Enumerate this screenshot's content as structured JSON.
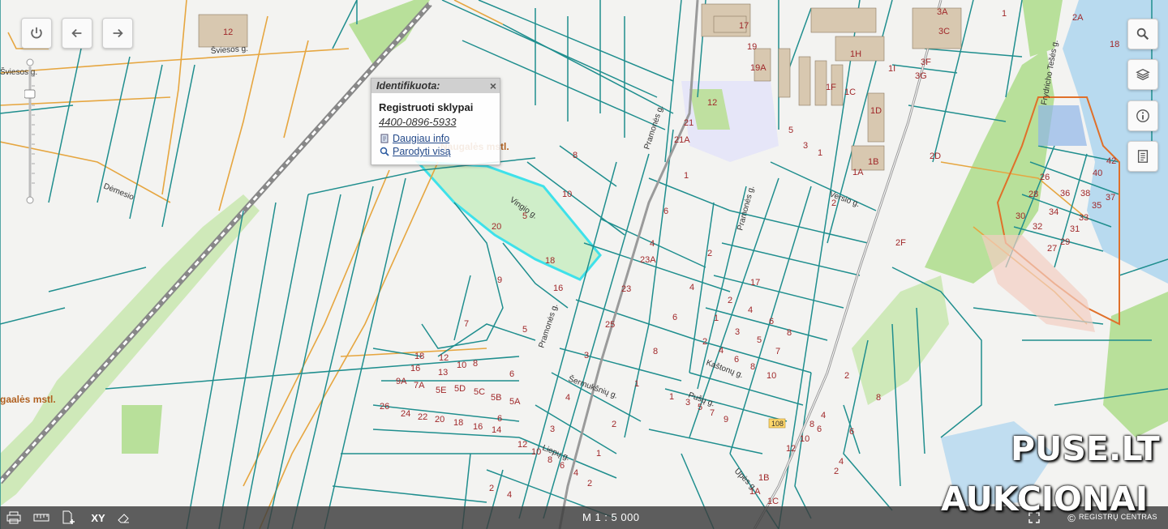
{
  "toolbar": {
    "power_icon": "power-icon",
    "back_icon": "arrow-left-icon",
    "forward_icon": "arrow-right-icon"
  },
  "right_tools": [
    "search-icon",
    "layers-icon",
    "info-icon",
    "legend-icon"
  ],
  "popup": {
    "title": "Identifikuota:",
    "close": "×",
    "section": "Registruoti sklypai",
    "plot_id": "4400-0896-5933",
    "more_info": "Daugiau info",
    "show_all": "Parodyti visą"
  },
  "streets": [
    "Šviesos g.",
    "Dėmesio",
    "Vingio g.",
    "Pramonės g.",
    "Verslo g.",
    "Pramonės g.",
    "Šermukšnių g.",
    "Kaštonų g.",
    "Pušų g.",
    "Liepų g.",
    "Upės g.",
    "Frydricho Tešės g."
  ],
  "places": [
    "Naugalės mstl.",
    "gaalės mstl."
  ],
  "road_number": "108",
  "plot_numbers": [
    "12",
    "1",
    "17",
    "19",
    "19A",
    "18",
    "12",
    "3A",
    "3C",
    "3F",
    "3G",
    "1A",
    "1H",
    "1I",
    "1F",
    "1C",
    "1D",
    "1B",
    "2A",
    "2",
    "3",
    "5",
    "1",
    "21",
    "21A",
    "1",
    "8",
    "10",
    "5",
    "20",
    "18",
    "6",
    "4",
    "23A",
    "2",
    "23",
    "4",
    "9",
    "16",
    "7",
    "5",
    "25",
    "6",
    "8",
    "3",
    "1",
    "4",
    "2",
    "3",
    "17",
    "2",
    "4",
    "6",
    "8",
    "1",
    "3",
    "5",
    "7",
    "2",
    "4",
    "6",
    "8",
    "10",
    "1",
    "3",
    "5",
    "7",
    "9",
    "2D",
    "2F",
    "26",
    "28",
    "30",
    "32",
    "34",
    "36",
    "38",
    "40",
    "42",
    "37",
    "35",
    "33",
    "31",
    "29",
    "27",
    "18",
    "12",
    "16",
    "13",
    "10",
    "8",
    "14",
    "9A",
    "7A",
    "5E",
    "5D",
    "5C",
    "5B",
    "5A",
    "6",
    "26",
    "24",
    "22",
    "20",
    "18",
    "16",
    "14",
    "12",
    "10",
    "8",
    "6",
    "4",
    "2",
    "1",
    "3",
    "2",
    "4",
    "6",
    "8",
    "12",
    "10",
    "8",
    "6",
    "4",
    "2",
    "1A",
    "1B",
    "1C",
    "4",
    "2"
  ],
  "bottom_bar": {
    "print_icon": "print-icon",
    "ruler_icon": "ruler-icon",
    "add_page_icon": "add-document-icon",
    "xy_label": "XY",
    "eraser_icon": "eraser-icon",
    "scale": "M 1 : 5 000",
    "fullscreen_icon": "fullscreen-icon",
    "registru": "REGISTRŲ CENTRAS"
  },
  "watermark": {
    "line1": "PUSE.LT",
    "line2": "AUKCIONAI"
  },
  "colors": {
    "parcel_line": "#1f8e8e",
    "highlight": "#33e0e8",
    "road": "#e6a640",
    "green": "#b9e29a",
    "water": "#a8d4ee"
  }
}
